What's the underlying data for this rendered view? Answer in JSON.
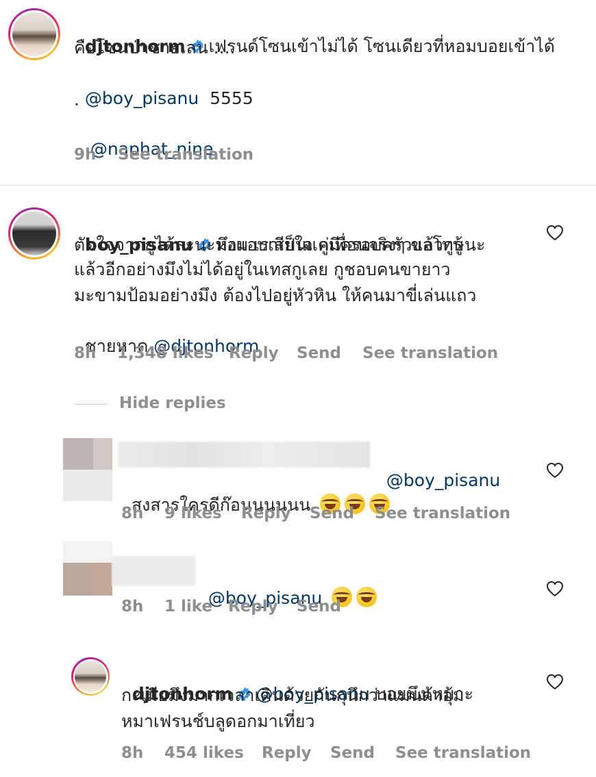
{
  "comments": [
    {
      "username": "djtonhorm",
      "text": "เฟรนด์โซนเข้าไม่ได้ โซนเดียวที่หอมบอยเข้าได้",
      "line2": "คือโซนป่าชายเลน ....",
      "mention1": "@boy_pisanu",
      "suffix1": "  5555",
      "dot": ".",
      "mention2": " @naphat_nine",
      "time": "9h",
      "translate": "See translation"
    },
    {
      "username": "boy_pisanu",
      "line1": "มึงแอบเสียใจ กูมีครอบครัวแล้วกูรู้",
      "line2": "ตัดใจจากกูได้ละนะหอม เราเป็นแค่เพื่อนจริงๆ ขอโทษนะ",
      "line3": "แล้วอีกอย่างมึงไม่ได้อยู่ในเทสกูเลย กูชอบคนขายาว",
      "line4": "มะขามป้อมอย่างมึง ต้องไปอยู่หัวหิน ให้คนมาขี่เล่นแถว",
      "line5": "ชายหาด ",
      "mention": "@djtonhorm",
      "time": "8h",
      "likes": "1,348 likes",
      "reply": "Reply",
      "send": "Send",
      "translate": "See translation"
    }
  ],
  "hide_replies": "Hide replies",
  "replies": [
    {
      "mention": "@boy_pisanu",
      "text": "สงสารใครดีก๊อนนนนนน ",
      "emoji": "rolling-on-floor-laughing x3",
      "time": "8h",
      "likes": "9 likes",
      "reply": "Reply",
      "send": "Send",
      "translate": "See translation"
    },
    {
      "mention": "@boy_pisanu",
      "emoji": "face-with-tears-of-joy x2",
      "time": "8h",
      "likes": "1 like",
      "reply": "Reply",
      "send": "Send"
    },
    {
      "username": "djtonhorm",
      "mention": "@boy_pisanu",
      "text1": " บอยมึงเหมาะ",
      "line2": "กะเมียมึงมากเวลาเดินด้วยกันกุนึกว่าแมนด้าอุ้ม",
      "line3": "หมาเฟรนช์บลูดอกมาเที่ยว",
      "time": "8h",
      "likes": "454 likes",
      "reply": "Reply",
      "send": "Send",
      "translate": "See translation"
    }
  ],
  "colors": {
    "text": "#262626",
    "mention": "#00376b",
    "meta": "#8e8e8e",
    "verified": "#3897f0"
  }
}
